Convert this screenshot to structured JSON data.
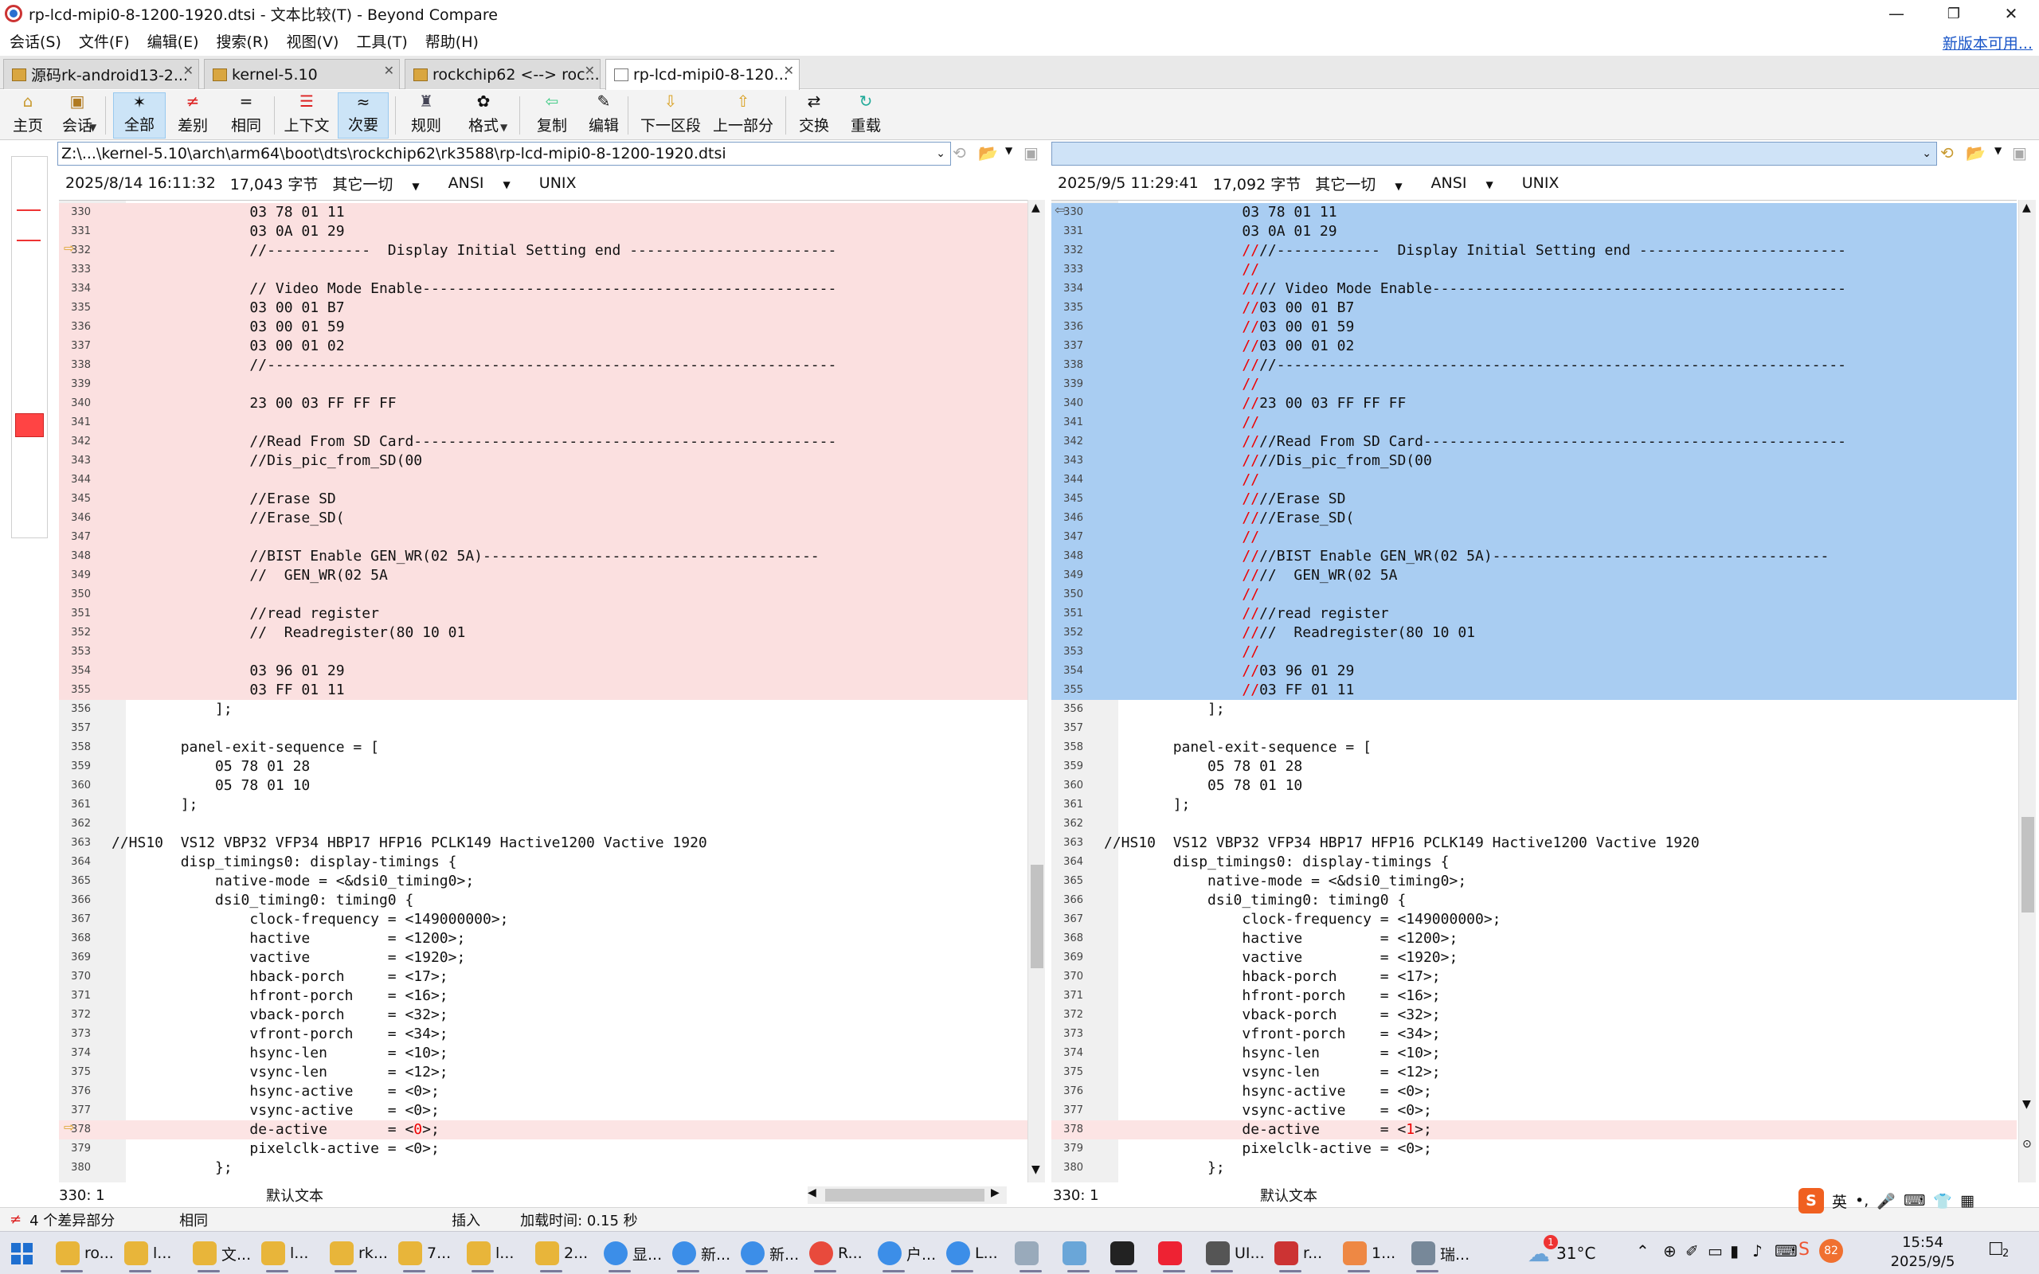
{
  "window": {
    "title": "rp-lcd-mipi0-8-1200-1920.dtsi - 文本比较(T) - Beyond Compare",
    "minimize": "—",
    "restore": "❐",
    "close": "✕"
  },
  "menu": [
    "会话(S)",
    "文件(F)",
    "编辑(E)",
    "搜索(R)",
    "视图(V)",
    "工具(T)",
    "帮助(H)"
  ],
  "new_version": "新版本可用...",
  "tabs": [
    {
      "label": "源码rk-android13-2..."
    },
    {
      "label": "kernel-5.10"
    },
    {
      "label": "rockchip62 <--> roc..."
    },
    {
      "label": "rp-lcd-mipi0-8-120..."
    }
  ],
  "toolbar": [
    {
      "label": "主页",
      "icon": "home-icon",
      "glyph": "⌂"
    },
    {
      "label": "会话",
      "icon": "briefcase-icon",
      "glyph": "▣"
    },
    {
      "label": "全部",
      "icon": "star-icon",
      "glyph": "✶"
    },
    {
      "label": "差别",
      "icon": "not-equal-icon",
      "glyph": "≠"
    },
    {
      "label": "相同",
      "icon": "equal-icon",
      "glyph": "="
    },
    {
      "label": "上下文",
      "icon": "context-icon",
      "glyph": "☰"
    },
    {
      "label": "次要",
      "icon": "minor-icon",
      "glyph": "≈"
    },
    {
      "label": "规则",
      "icon": "rules-icon",
      "glyph": "♜"
    },
    {
      "label": "格式",
      "icon": "format-icon",
      "glyph": "✿"
    },
    {
      "label": "复制",
      "icon": "copy-left-icon",
      "glyph": "⇦"
    },
    {
      "label": "编辑",
      "icon": "edit-icon",
      "glyph": "✎"
    },
    {
      "label": "下一区段",
      "icon": "next-section-icon",
      "glyph": "⇩"
    },
    {
      "label": "上一部分",
      "icon": "prev-section-icon",
      "glyph": "⇧"
    },
    {
      "label": "交换",
      "icon": "swap-icon",
      "glyph": "⇄"
    },
    {
      "label": "重载",
      "icon": "reload-icon",
      "glyph": "↻"
    }
  ],
  "left": {
    "path": "Z:\\...\\kernel-5.10\\arch\\arm64\\boot\\dts\\rockchip62\\rk3588\\rp-lcd-mipi0-8-1200-1920.dtsi",
    "date": "2025/8/14 16:11:32",
    "size": "17,043 字节",
    "other": "其它一切",
    "encoding": "ANSI",
    "eol": "UNIX",
    "cursor": "330: 1",
    "mode": "默认文本"
  },
  "right": {
    "path": "",
    "date": "2025/9/5 11:29:41",
    "size": "17,092 字节",
    "other": "其它一切",
    "encoding": "ANSI",
    "eol": "UNIX",
    "cursor": "330: 1",
    "mode": "默认文本"
  },
  "lines": [
    {
      "n": "330",
      "l": "\t\t\t\t03 78 01 11",
      "rp": "",
      "r": "\t\t\t\t03 78 01 11",
      "d": 1
    },
    {
      "n": "331",
      "l": "\t\t\t\t03 0A 01 29",
      "rp": "",
      "r": "\t\t\t\t03 0A 01 29",
      "d": 1
    },
    {
      "n": "332",
      "l": "\t\t\t\t//------------  Display Initial Setting end ------------------------",
      "rp": "//",
      "r": "//------------  Display Initial Setting end ------------------------",
      "d": 1
    },
    {
      "n": "333",
      "l": "",
      "rp": "//",
      "r": "",
      "d": 1
    },
    {
      "n": "334",
      "l": "\t\t\t\t// Video Mode Enable------------------------------------------------",
      "rp": "//",
      "r": "// Video Mode Enable------------------------------------------------",
      "d": 1
    },
    {
      "n": "335",
      "l": "\t\t\t\t03 00 01 B7",
      "rp": "//",
      "r": "03 00 01 B7",
      "d": 1
    },
    {
      "n": "336",
      "l": "\t\t\t\t03 00 01 59",
      "rp": "//",
      "r": "03 00 01 59",
      "d": 1
    },
    {
      "n": "337",
      "l": "\t\t\t\t03 00 01 02",
      "rp": "//",
      "r": "03 00 01 02",
      "d": 1
    },
    {
      "n": "338",
      "l": "\t\t\t\t//------------------------------------------------------------------",
      "rp": "//",
      "r": "//------------------------------------------------------------------",
      "d": 1
    },
    {
      "n": "339",
      "l": "",
      "rp": "//",
      "r": "",
      "d": 1
    },
    {
      "n": "340",
      "l": "\t\t\t\t23 00 03 FF FF FF",
      "rp": "//",
      "r": "23 00 03 FF FF FF",
      "d": 1
    },
    {
      "n": "341",
      "l": "",
      "rp": "//",
      "r": "",
      "d": 1
    },
    {
      "n": "342",
      "l": "\t\t\t\t//Read From SD Card-------------------------------------------------",
      "rp": "//",
      "r": "//Read From SD Card-------------------------------------------------",
      "d": 1
    },
    {
      "n": "343",
      "l": "\t\t\t\t//Dis_pic_from_SD(00",
      "rp": "//",
      "r": "//Dis_pic_from_SD(00",
      "d": 1
    },
    {
      "n": "344",
      "l": "",
      "rp": "//",
      "r": "",
      "d": 1
    },
    {
      "n": "345",
      "l": "\t\t\t\t//Erase SD",
      "rp": "//",
      "r": "//Erase SD",
      "d": 1
    },
    {
      "n": "346",
      "l": "\t\t\t\t//Erase_SD(",
      "rp": "//",
      "r": "//Erase_SD(",
      "d": 1
    },
    {
      "n": "347",
      "l": "",
      "rp": "//",
      "r": "",
      "d": 1
    },
    {
      "n": "348",
      "l": "\t\t\t\t//BIST Enable GEN_WR(02 5A)---------------------------------------",
      "rp": "//",
      "r": "//BIST Enable GEN_WR(02 5A)---------------------------------------",
      "d": 1
    },
    {
      "n": "349",
      "l": "\t\t\t\t//  GEN_WR(02 5A",
      "rp": "//",
      "r": "//  GEN_WR(02 5A",
      "d": 1
    },
    {
      "n": "350",
      "l": "",
      "rp": "//",
      "r": "",
      "d": 1
    },
    {
      "n": "351",
      "l": "\t\t\t\t//read register",
      "rp": "//",
      "r": "//read register",
      "d": 1
    },
    {
      "n": "352",
      "l": "\t\t\t\t//  Readregister(80 10 01",
      "rp": "//",
      "r": "//  Readregister(80 10 01",
      "d": 1
    },
    {
      "n": "353",
      "l": "",
      "rp": "//",
      "r": "",
      "d": 1
    },
    {
      "n": "354",
      "l": "\t\t\t\t03 96 01 29",
      "rp": "//",
      "r": "03 96 01 29",
      "d": 1
    },
    {
      "n": "355",
      "l": "\t\t\t\t03 FF 01 11",
      "rp": "//",
      "r": "03 FF 01 11",
      "d": 1
    },
    {
      "n": "356",
      "l": "\t\t\t];",
      "rp": "",
      "r": "\t\t\t];",
      "d": 0
    },
    {
      "n": "357",
      "l": "",
      "rp": "",
      "r": "",
      "d": 0
    },
    {
      "n": "358",
      "l": "\t\tpanel-exit-sequence = [",
      "rp": "",
      "r": "\t\tpanel-exit-sequence = [",
      "d": 0
    },
    {
      "n": "359",
      "l": "\t\t\t05 78 01 28",
      "rp": "",
      "r": "\t\t\t05 78 01 28",
      "d": 0
    },
    {
      "n": "360",
      "l": "\t\t\t05 78 01 10",
      "rp": "",
      "r": "\t\t\t05 78 01 10",
      "d": 0
    },
    {
      "n": "361",
      "l": "\t\t];",
      "rp": "",
      "r": "\t\t];",
      "d": 0
    },
    {
      "n": "362",
      "l": "",
      "rp": "",
      "r": "",
      "d": 0
    },
    {
      "n": "363",
      "l": "//HS10\tVS12 VBP32 VFP34 HBP17 HFP16 PCLK149 Hactive1200 Vactive 1920",
      "rp": "",
      "r": "//HS10\tVS12 VBP32 VFP34 HBP17 HFP16 PCLK149 Hactive1200 Vactive 1920",
      "d": 0
    },
    {
      "n": "364",
      "l": "\t\tdisp_timings0: display-timings {",
      "rp": "",
      "r": "\t\tdisp_timings0: display-timings {",
      "d": 0
    },
    {
      "n": "365",
      "l": "\t\t\tnative-mode = <&dsi0_timing0>;",
      "rp": "",
      "r": "\t\t\tnative-mode = <&dsi0_timing0>;",
      "d": 0
    },
    {
      "n": "366",
      "l": "\t\t\tdsi0_timing0: timing0 {",
      "rp": "",
      "r": "\t\t\tdsi0_timing0: timing0 {",
      "d": 0
    },
    {
      "n": "367",
      "l": "\t\t\t\tclock-frequency = <149000000>;",
      "rp": "",
      "r": "\t\t\t\tclock-frequency = <149000000>;",
      "d": 0
    },
    {
      "n": "368",
      "l": "\t\t\t\thactive         = <1200>;",
      "rp": "",
      "r": "\t\t\t\thactive         = <1200>;",
      "d": 0
    },
    {
      "n": "369",
      "l": "\t\t\t\tvactive         = <1920>;",
      "rp": "",
      "r": "\t\t\t\tvactive         = <1920>;",
      "d": 0
    },
    {
      "n": "370",
      "l": "\t\t\t\thback-porch     = <17>;",
      "rp": "",
      "r": "\t\t\t\thback-porch     = <17>;",
      "d": 0
    },
    {
      "n": "371",
      "l": "\t\t\t\thfront-porch    = <16>;",
      "rp": "",
      "r": "\t\t\t\thfront-porch    = <16>;",
      "d": 0
    },
    {
      "n": "372",
      "l": "\t\t\t\tvback-porch     = <32>;",
      "rp": "",
      "r": "\t\t\t\tvback-porch     = <32>;",
      "d": 0
    },
    {
      "n": "373",
      "l": "\t\t\t\tvfront-porch    = <34>;",
      "rp": "",
      "r": "\t\t\t\tvfront-porch    = <34>;",
      "d": 0
    },
    {
      "n": "374",
      "l": "\t\t\t\thsync-len       = <10>;",
      "rp": "",
      "r": "\t\t\t\thsync-len       = <10>;",
      "d": 0
    },
    {
      "n": "375",
      "l": "\t\t\t\tvsync-len       = <12>;",
      "rp": "",
      "r": "\t\t\t\tvsync-len       = <12>;",
      "d": 0
    },
    {
      "n": "376",
      "l": "\t\t\t\thsync-active    = <0>;",
      "rp": "",
      "r": "\t\t\t\thsync-active    = <0>;",
      "d": 0
    },
    {
      "n": "377",
      "l": "\t\t\t\tvsync-active    = <0>;",
      "rp": "",
      "r": "\t\t\t\tvsync-active    = <0>;",
      "d": 0
    },
    {
      "n": "378",
      "l": "\t\t\t\tde-active       = <0>;",
      "rp": "",
      "r": "\t\t\t\tde-active       = <1>;",
      "d": 2
    },
    {
      "n": "379",
      "l": "\t\t\t\tpixelclk-active = <0>;",
      "rp": "",
      "r": "\t\t\t\tpixelclk-active = <0>;",
      "d": 0
    },
    {
      "n": "380",
      "l": "\t\t\t};",
      "rp": "",
      "r": "\t\t\t};",
      "d": 0
    }
  ],
  "bottom": {
    "diffs": "4 个差异部分",
    "same": "相同",
    "insert": "插入",
    "load_time": "加载时间: 0.15 秒"
  },
  "taskbar": {
    "items": [
      {
        "label": "ro...",
        "color": "#e8b53a"
      },
      {
        "label": "l...",
        "color": "#e8b53a"
      },
      {
        "label": "文...",
        "color": "#e8b53a"
      },
      {
        "label": "l...",
        "color": "#e8b53a"
      },
      {
        "label": "rk...",
        "color": "#e8b53a"
      },
      {
        "label": "7...",
        "color": "#e8b53a"
      },
      {
        "label": "l...",
        "color": "#e8b53a"
      },
      {
        "label": "2...",
        "color": "#e8b53a"
      },
      {
        "label": "显...",
        "color": "#3c8ee8"
      },
      {
        "label": "新...",
        "color": "#3c8ee8"
      },
      {
        "label": "新...",
        "color": "#3c8ee8"
      },
      {
        "label": "R...",
        "color": "#e84a3c"
      },
      {
        "label": "户...",
        "color": "#3c8ee8"
      },
      {
        "label": "L...",
        "color": "#3c8ee8"
      },
      {
        "label": "",
        "color": "#9ab"
      },
      {
        "label": "",
        "color": "#6aa6d8"
      },
      {
        "label": "",
        "color": "#222"
      },
      {
        "label": "",
        "color": "#e23"
      },
      {
        "label": "UI...",
        "color": "#555"
      },
      {
        "label": "r...",
        "color": "#c33"
      },
      {
        "label": "1...",
        "color": "#e84"
      },
      {
        "label": "瑞...",
        "color": "#789"
      }
    ],
    "weather": "31°C",
    "weather_badge": "1",
    "ime": "英",
    "battery": "82",
    "time": "15:54",
    "date": "2025/9/5",
    "notif": "2"
  },
  "colors": {
    "left_diff_bg": "#fbe0e0",
    "right_diff_bg": "#a9cdf2",
    "diff_text": "#e00000",
    "accent": "#1a56c8"
  }
}
